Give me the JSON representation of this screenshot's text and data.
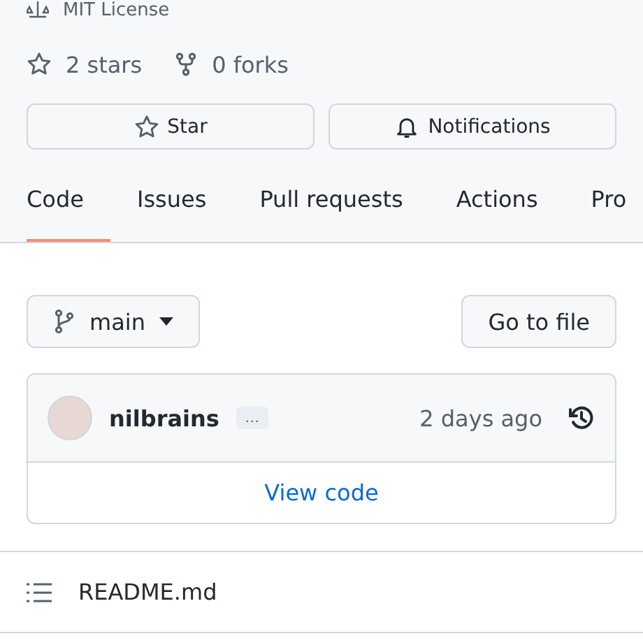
{
  "license": "MIT License",
  "stats": [
    {
      "kind": "stars",
      "label": "2 stars"
    },
    {
      "kind": "forks",
      "label": "0 forks"
    }
  ],
  "actions": [
    {
      "kind": "star",
      "label": "Star"
    },
    {
      "kind": "bell",
      "label": "Notifications"
    }
  ],
  "tabs": [
    {
      "label": "Code",
      "selected": true
    },
    {
      "label": "Issues",
      "selected": false
    },
    {
      "label": "Pull requests",
      "selected": false
    },
    {
      "label": "Actions",
      "selected": false
    },
    {
      "label": "Pro",
      "selected": false
    }
  ],
  "branch": {
    "name": "main"
  },
  "go_to_file": "Go to file",
  "commit": {
    "author": "nilbrains",
    "more": "…",
    "time": "2 days ago"
  },
  "view_code": "View code",
  "readme": "README.md"
}
